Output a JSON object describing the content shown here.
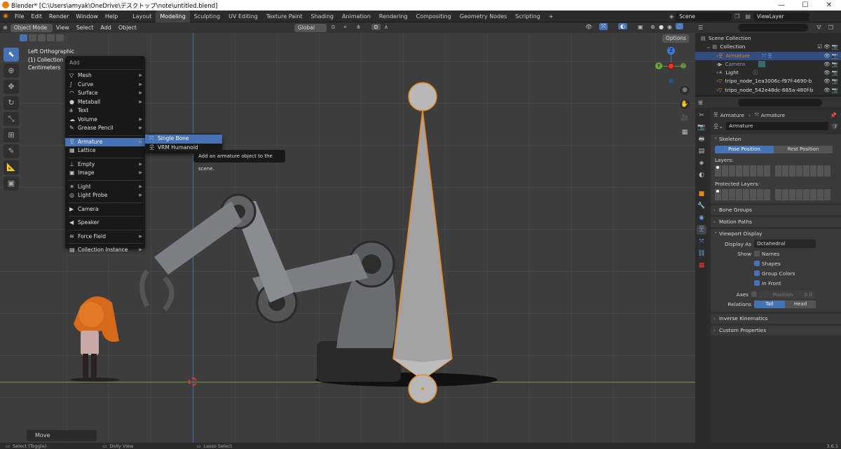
{
  "titlebar": {
    "title": "Blender* [C:\\Users\\amyak\\OneDrive\\デスクトップ\\note\\untitled.blend]",
    "minimize": "—",
    "maximize": "☐",
    "close": "✕"
  },
  "menubar": {
    "menus": [
      "File",
      "Edit",
      "Render",
      "Window",
      "Help"
    ],
    "workspaces": [
      "Layout",
      "Modeling",
      "Sculpting",
      "UV Editing",
      "Texture Paint",
      "Shading",
      "Animation",
      "Rendering",
      "Compositing",
      "Geometry Nodes",
      "Scripting"
    ],
    "active_workspace": "Modeling",
    "add_tab": "+",
    "scene": "Scene",
    "view_layer": "ViewLayer"
  },
  "viewport_header": {
    "mode": "Object Mode",
    "menus": [
      "View",
      "Select",
      "Add",
      "Object"
    ],
    "transform": "Global",
    "options": "Options"
  },
  "viewport": {
    "view_name": "Left Orthographic",
    "collection_info": "(1) Collection | A",
    "units": "Centimeters",
    "gizmo": {
      "z": "Z",
      "y": "Y"
    },
    "last_op": "Move"
  },
  "add_menu": {
    "title": "Add",
    "items": [
      {
        "label": "Mesh",
        "icon": "▽",
        "sub": true
      },
      {
        "label": "Curve",
        "icon": "∫",
        "sub": true
      },
      {
        "label": "Surface",
        "icon": "◠",
        "sub": true
      },
      {
        "label": "Metaball",
        "icon": "●",
        "sub": true
      },
      {
        "label": "Text",
        "icon": "a",
        "sub": false
      },
      {
        "label": "Volume",
        "icon": "☁",
        "sub": true
      },
      {
        "label": "Grease Pencil",
        "icon": "✎",
        "sub": true
      },
      {
        "label": "Armature",
        "icon": "웃",
        "sub": true
      },
      {
        "label": "Lattice",
        "icon": "▦",
        "sub": false
      },
      {
        "label": "Empty",
        "icon": "⊥",
        "sub": true
      },
      {
        "label": "Image",
        "icon": "▣",
        "sub": true
      },
      {
        "label": "Light",
        "icon": "☀",
        "sub": true
      },
      {
        "label": "Light Probe",
        "icon": "◎",
        "sub": true
      },
      {
        "label": "Camera",
        "icon": "▶",
        "sub": false
      },
      {
        "label": "Speaker",
        "icon": "◀",
        "sub": false
      },
      {
        "label": "Force Field",
        "icon": "≋",
        "sub": true
      },
      {
        "label": "Collection Instance",
        "icon": "▤",
        "sub": true
      }
    ]
  },
  "armature_submenu": {
    "items": [
      "Single Bone",
      "VRM Humanoid"
    ]
  },
  "tooltip": "Add an armature object to the scene.",
  "outliner": {
    "root": "Scene Collection",
    "collection": "Collection",
    "items": [
      "Armature",
      "Camera",
      "Light",
      "tripo_node_1ea3006c-f97f-4690-b",
      "tripo_node_542e48dc-685a-480f-b"
    ]
  },
  "properties": {
    "breadcrumb": [
      "Armature",
      "Armature"
    ],
    "data_name": "Armature",
    "skeleton": "Skeleton",
    "pose_position": "Pose Position",
    "rest_position": "Rest Position",
    "layers": "Layers:",
    "protected_layers": "Protected Layers:",
    "bone_groups": "Bone Groups",
    "motion_paths": "Motion Paths",
    "viewport_display": "Viewport Display",
    "display_as_label": "Display As",
    "display_as": "Octahedral",
    "show_label": "Show",
    "names": "Names",
    "shapes": "Shapes",
    "group_colors": "Group Colors",
    "in_front": "In Front",
    "axes_label": "Axes",
    "position": "Position",
    "position_val": "0.0",
    "relations_label": "Relations",
    "tail": "Tail",
    "head": "Head",
    "inverse_kinematics": "Inverse Kinematics",
    "custom_properties": "Custom Properties"
  },
  "status": {
    "select": "Select (Toggle)",
    "dolly": "Dolly View",
    "lasso": "Lasso Select",
    "version": "3.6.1"
  }
}
